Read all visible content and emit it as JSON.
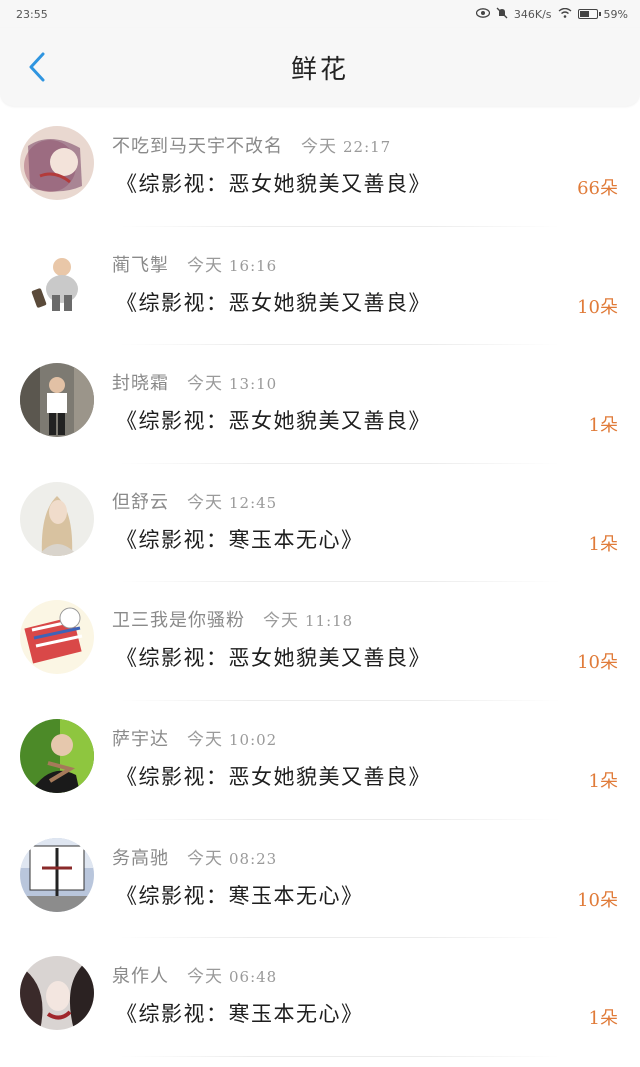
{
  "status": {
    "time": "23:55",
    "speed": "346K/s",
    "battery": "59%"
  },
  "header": {
    "title": "鲜花"
  },
  "rows": [
    {
      "name": "不吃到马天宇不改名",
      "day": "今天",
      "clock": "22:17",
      "book": "《综影视：恶女她貌美又善良》",
      "count": "66朵"
    },
    {
      "name": "蔺飞掣",
      "day": "今天",
      "clock": "16:16",
      "book": "《综影视：恶女她貌美又善良》",
      "count": "10朵"
    },
    {
      "name": "封晓霜",
      "day": "今天",
      "clock": "13:10",
      "book": "《综影视：恶女她貌美又善良》",
      "count": "1朵"
    },
    {
      "name": "但舒云",
      "day": "今天",
      "clock": "12:45",
      "book": "《综影视：寒玉本无心》",
      "count": "1朵"
    },
    {
      "name": "卫三我是你骚粉",
      "day": "今天",
      "clock": "11:18",
      "book": "《综影视：恶女她貌美又善良》",
      "count": "10朵"
    },
    {
      "name": "萨宇达",
      "day": "今天",
      "clock": "10:02",
      "book": "《综影视：恶女她貌美又善良》",
      "count": "1朵"
    },
    {
      "name": "务高驰",
      "day": "今天",
      "clock": "08:23",
      "book": "《综影视：寒玉本无心》",
      "count": "10朵"
    },
    {
      "name": "泉作人",
      "day": "今天",
      "clock": "06:48",
      "book": "《综影视：寒玉本无心》",
      "count": "1朵"
    }
  ],
  "colors": {
    "accent": "#2f95e0",
    "count": "#e07b39"
  }
}
